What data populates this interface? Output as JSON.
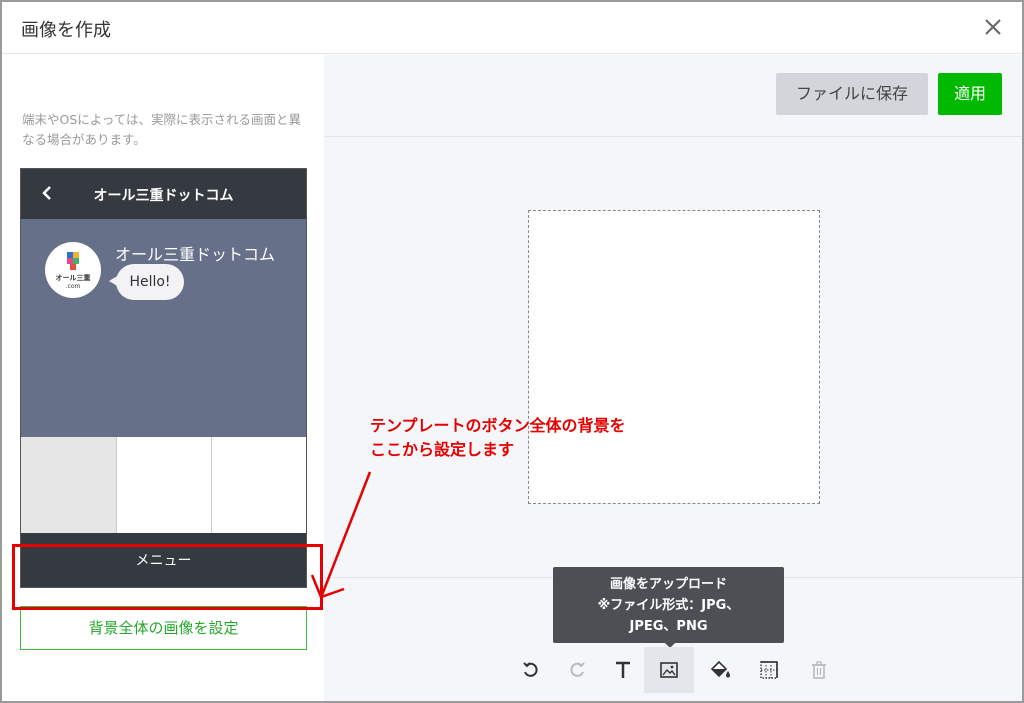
{
  "dialog": {
    "title": "画像を作成",
    "close_icon": "close-icon"
  },
  "left_panel": {
    "note": "端末やOSによっては、実際に表示される画面と異なる場合があります。",
    "phone": {
      "back_icon": "chevron-left-icon",
      "header_title": "オール三重ドットコム",
      "account_name": "オール三重ドットコム",
      "avatar_logo_text_1": "オール三重",
      "avatar_logo_text_2": ".com",
      "chat_message": "Hello!",
      "menu_label": "メニュー",
      "menu_cells": 3,
      "colors": {
        "chat_bg": "#667089",
        "header_bg": "#353a41"
      }
    },
    "set_background_button": "背景全体の画像を設定"
  },
  "right_panel": {
    "save_file_button": "ファイルに保存",
    "apply_button": "適用",
    "tooltip": {
      "line1": "画像をアップロード",
      "line2": "※ファイル形式：JPG、",
      "line3": "JPEG、PNG"
    },
    "tools": [
      {
        "name": "undo",
        "icon": "undo-icon",
        "enabled": true
      },
      {
        "name": "redo",
        "icon": "redo-icon",
        "enabled": false
      },
      {
        "name": "text",
        "icon": "text-icon",
        "enabled": true
      },
      {
        "name": "image",
        "icon": "image-icon",
        "enabled": true,
        "active": true
      },
      {
        "name": "fill",
        "icon": "paint-bucket-icon",
        "enabled": true
      },
      {
        "name": "grid",
        "icon": "grid-icon",
        "enabled": true
      },
      {
        "name": "delete",
        "icon": "trash-icon",
        "enabled": false
      }
    ]
  },
  "annotation": {
    "line1": "テンプレートのボタン全体の背景を",
    "line2": "ここから設定します",
    "color": "#e60000"
  },
  "colors": {
    "accent_green": "#00b900",
    "annotation_red": "#e60000"
  }
}
